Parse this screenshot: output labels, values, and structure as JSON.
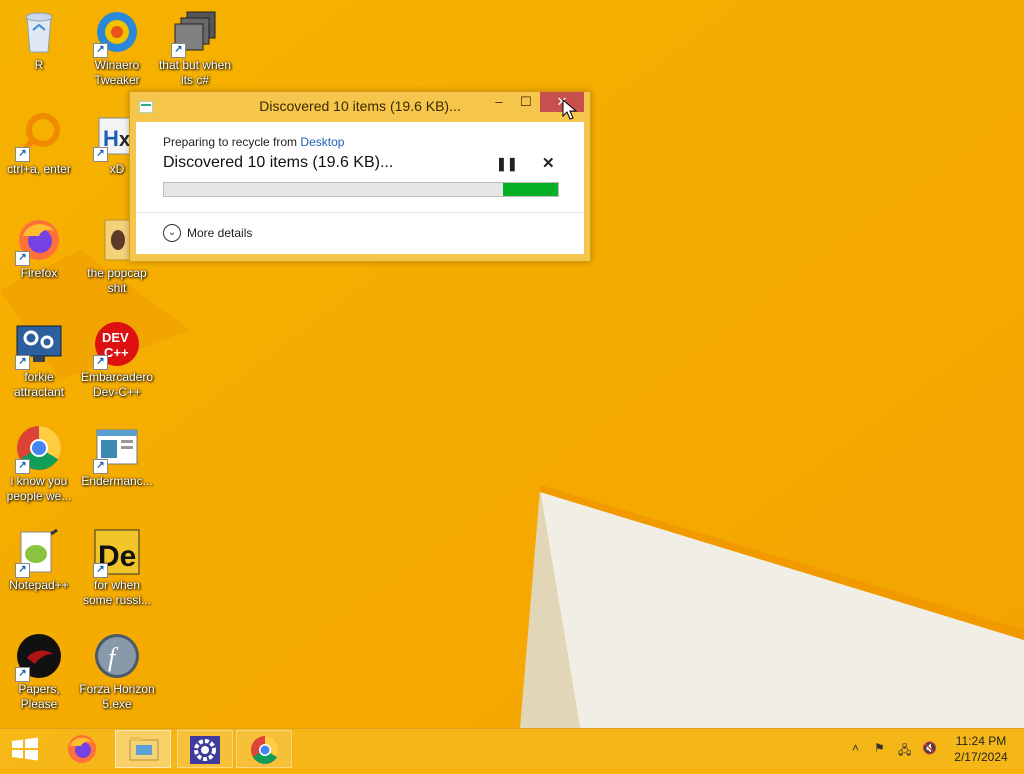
{
  "desktop": {
    "icons": [
      {
        "label": "R",
        "icon": "recycle-bin-icon"
      },
      {
        "label": "Winaero Tweaker",
        "icon": "winaero-icon"
      },
      {
        "label": "that but when its c#",
        "icon": "stacked-windows-icon"
      },
      {
        "label": "ctrl+a, enter",
        "icon": "search-ring-icon"
      },
      {
        "label": "xD",
        "icon": "hx-icon"
      },
      {
        "label": "Firefox",
        "icon": "firefox-icon"
      },
      {
        "label": "the popcap shit",
        "icon": "folder-icon"
      },
      {
        "label": "forkie attractant",
        "icon": "monitor-gear-icon"
      },
      {
        "label": "Embarcadero Dev-C++",
        "icon": "devcpp-icon"
      },
      {
        "label": "i know you people we...",
        "icon": "chrome-icon"
      },
      {
        "label": "Endermanc...",
        "icon": "window-app-icon"
      },
      {
        "label": "Notepad++",
        "icon": "notepadpp-icon"
      },
      {
        "label": "for when some russi...",
        "icon": "de-icon"
      },
      {
        "label": "Papers, Please",
        "icon": "papers-please-icon"
      },
      {
        "label": "Forza Horizon 5.exe",
        "icon": "flash-icon"
      }
    ]
  },
  "dialog": {
    "title": "Discovered 10 items (19.6 KB)...",
    "min_glyph": "–",
    "max_glyph": "☐",
    "close_glyph": "✕",
    "prep_text": "Preparing to recycle from",
    "prep_link": "Desktop",
    "status": "Discovered 10 items (19.6 KB)...",
    "pause_glyph": "❚❚",
    "cancel_glyph": "✕",
    "progress_fraction": 0.14,
    "more_chevron": "⌄",
    "more_details": "More details",
    "colors": {
      "progress_fill": "#06b025",
      "close_button": "#c7504f",
      "frame": "#f5c64b"
    }
  },
  "taskbar": {
    "items": [
      {
        "name": "start-button",
        "icon": "windows-logo-icon"
      },
      {
        "name": "firefox",
        "icon": "firefox-icon"
      },
      {
        "name": "file-explorer",
        "icon": "folder-icon"
      },
      {
        "name": "settings-app",
        "icon": "gear-icon"
      },
      {
        "name": "chrome",
        "icon": "chrome-icon"
      }
    ],
    "tray_glyphs": {
      "show_hidden": "˄",
      "flag": "⚑",
      "network": "🖧",
      "volume": "🔇"
    },
    "clock": {
      "time": "11:24 PM",
      "date": "2/17/2024"
    }
  }
}
